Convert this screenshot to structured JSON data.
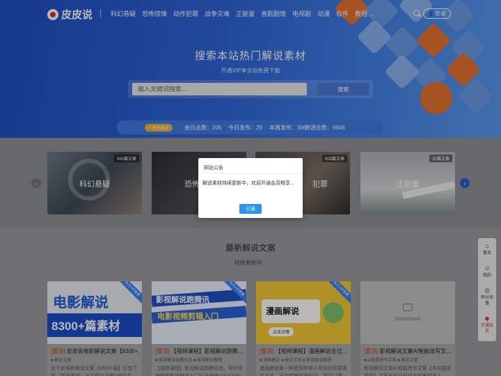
{
  "header": {
    "logo_text": "皮皮说",
    "menu": [
      "科幻悬疑",
      "恐怖惊悚",
      "动作犯罪",
      "战争灾难",
      "正能量",
      "喜剧剧情",
      "电视剧",
      "动漫",
      "软件",
      "教程"
    ],
    "login_label": "登录"
  },
  "hero": {
    "title": "搜索本站热门解说素材",
    "subtitle": "开通VIP享全站免费下载",
    "search_placeholder": "输入关键词搜索...",
    "search_button": "搜索"
  },
  "stats": {
    "badge": "平台统计",
    "items": [
      "会员总数：205",
      "今日发布：29",
      "本周发布：306",
      "资源总数：9946"
    ]
  },
  "categories": [
    {
      "label": "科幻悬疑",
      "count": "560篇文章"
    },
    {
      "label": "恐怖惊悚",
      "count": ""
    },
    {
      "label": "犯罪",
      "count": "608篇文章"
    },
    {
      "label": "正能量",
      "count": "92篇文章"
    }
  ],
  "latest": {
    "title": "最新解说文案",
    "subtitle": "持续更新中..."
  },
  "posts": [
    {
      "thumb_line1": "电影解说",
      "thumb_line2": "8300+篇素材",
      "ribbon": "永久VIP免费",
      "tag": "[置顶]",
      "title": " 皮皮说电影解说文案【8300+...",
      "meta": "■ 解说文案",
      "excerpt": "豆子皮电影解说文案【8500+篇】打包下载（独家资源）为方便日子电VIP会员..."
    },
    {
      "thumb_line1": "影视解说跑腾讯",
      "thumb_line2": "电影视频剪辑入门",
      "ribbon": "永久VIP免费",
      "tag": "[置顶]",
      "title": " 【视频课程】影视解说跑腾...",
      "meta": "■ 影视解说跑腾讯流 ■ 影视解说教程",
      "excerpt": "【视频课程】影视解说跑腾讯流，帮你快速转型影视解说人门玩法快速从0-100W..."
    },
    {
      "thumb_line1": "漫画解说",
      "thumb_line2": "点击详情",
      "ribbon": "永久VIP免费",
      "tag": "[置顶]",
      "title": " 【视频课程】漫画解说全过...",
      "meta": "■ 漫画解说 ■ 解说文案 ■ 影视解说教程",
      "excerpt": "漫画解说是一种受到年轻人欢迎的创意表达方式，不仅能够传递知识，还可以展示..."
    },
    {
      "thumb_line1": "thumbnail",
      "thumb_line2": "",
      "ribbon": "",
      "tag": "[置顶]",
      "title": " 影视解说文案AI智能改写文...",
      "meta": "■ AI智能改写文案 ■ 解说文案",
      "excerpt": "影视解说文案AI智能改写文案【本站独家提供】文案写作已经成为越来越多人..."
    }
  ],
  "side_toolbar": [
    "首页",
    "我的",
    "积分充值",
    "开通会员"
  ],
  "modal": {
    "title": "网站公告",
    "body": "解说素材持续更新中，欢迎开通会员畅享...",
    "button": "已读"
  },
  "colors": {
    "accent": "#2196f3",
    "orange": "#e8742e",
    "brand_blue": "#2f66d8"
  }
}
